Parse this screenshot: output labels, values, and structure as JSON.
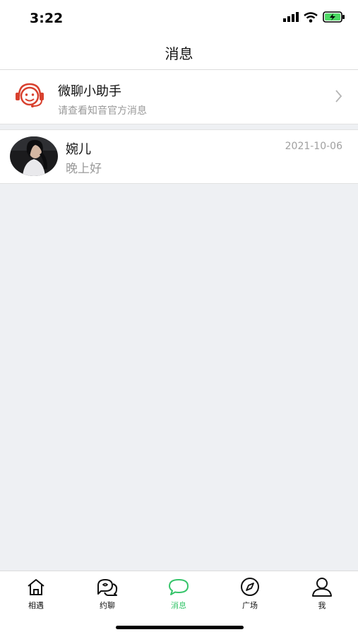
{
  "status_bar": {
    "time": "3:22",
    "icons": [
      "signal-icon",
      "wifi-icon",
      "battery-charging-icon"
    ]
  },
  "nav": {
    "title": "消息"
  },
  "assistant": {
    "title": "微聊小助手",
    "subtitle": "请查看知音官方消息",
    "icon": "headset-smiley-icon",
    "accent": "#d8412f"
  },
  "conversations": [
    {
      "name": "婉儿",
      "preview": "晚上好",
      "date": "2021-10-06"
    }
  ],
  "tabs": [
    {
      "label": "相遇",
      "icon": "home-icon",
      "active": false
    },
    {
      "label": "约聊",
      "icon": "chat-bubbles-icon",
      "active": false
    },
    {
      "label": "消息",
      "icon": "message-icon",
      "active": true
    },
    {
      "label": "广场",
      "icon": "compass-icon",
      "active": false
    },
    {
      "label": "我",
      "icon": "person-icon",
      "active": false
    }
  ],
  "colors": {
    "active_tab": "#36c46a",
    "background": "#eef0f3"
  }
}
